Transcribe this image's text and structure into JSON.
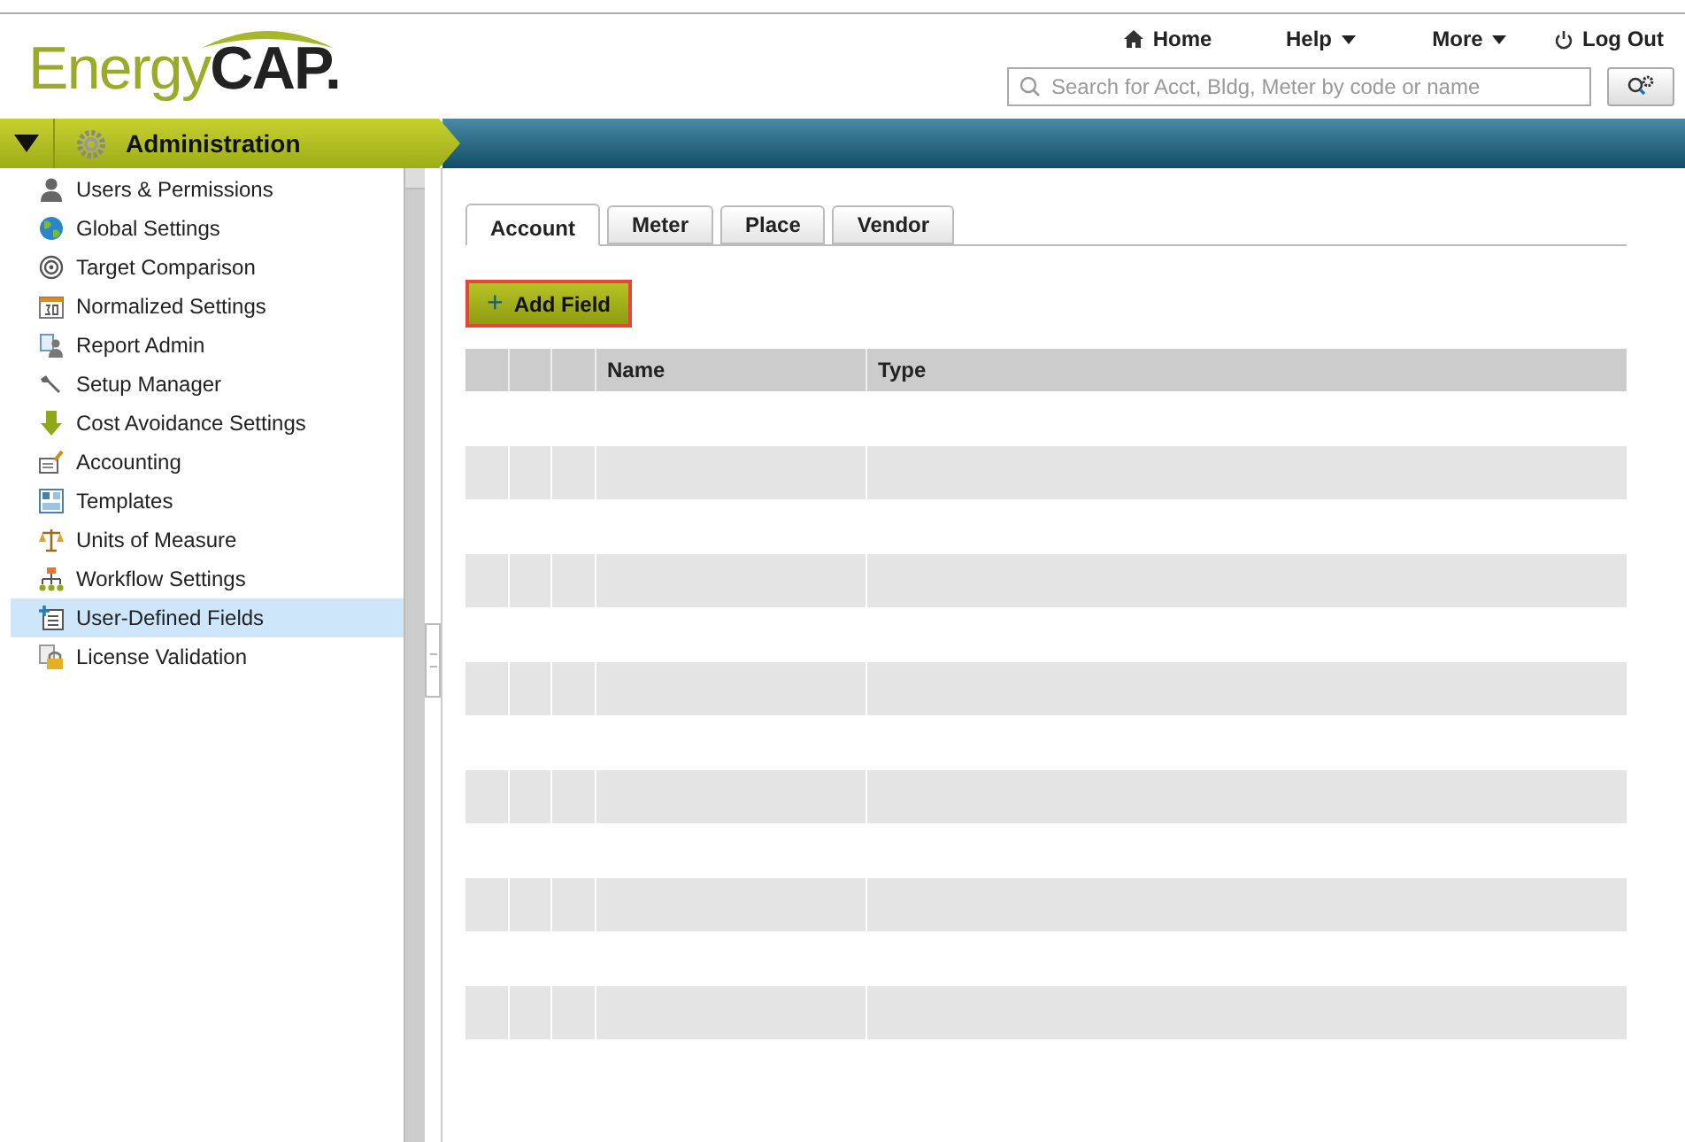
{
  "logo": {
    "light": "Energy",
    "bold": "CAP."
  },
  "top_nav": [
    {
      "label": "Home",
      "kind": "home"
    },
    {
      "label": "Help",
      "kind": "menu"
    },
    {
      "label": "More",
      "kind": "menu"
    },
    {
      "label": "Log Out",
      "kind": "power"
    }
  ],
  "search": {
    "placeholder": "Search for Acct, Bldg, Meter by code or name"
  },
  "module": {
    "title": "Administration",
    "expanded": true
  },
  "sidebar": {
    "items": [
      {
        "label": "Users & Permissions",
        "selected": false
      },
      {
        "label": "Global Settings",
        "selected": false
      },
      {
        "label": "Target Comparison",
        "selected": false
      },
      {
        "label": "Normalized Settings",
        "selected": false
      },
      {
        "label": "Report Admin",
        "selected": false
      },
      {
        "label": "Setup Manager",
        "selected": false
      },
      {
        "label": "Cost Avoidance Settings",
        "selected": false
      },
      {
        "label": "Accounting",
        "selected": false
      },
      {
        "label": "Templates",
        "selected": false
      },
      {
        "label": "Units of Measure",
        "selected": false
      },
      {
        "label": "Workflow Settings",
        "selected": false
      },
      {
        "label": "User-Defined Fields",
        "selected": true
      },
      {
        "label": "License Validation",
        "selected": false
      }
    ]
  },
  "tabs": [
    {
      "label": "Account",
      "selected": true
    },
    {
      "label": "Meter",
      "selected": false
    },
    {
      "label": "Place",
      "selected": false
    },
    {
      "label": "Vendor",
      "selected": false
    }
  ],
  "add_button": {
    "label": "Add Field",
    "icon": "+"
  },
  "table": {
    "columns": [
      {
        "label": "Name"
      },
      {
        "label": "Type"
      }
    ]
  }
}
